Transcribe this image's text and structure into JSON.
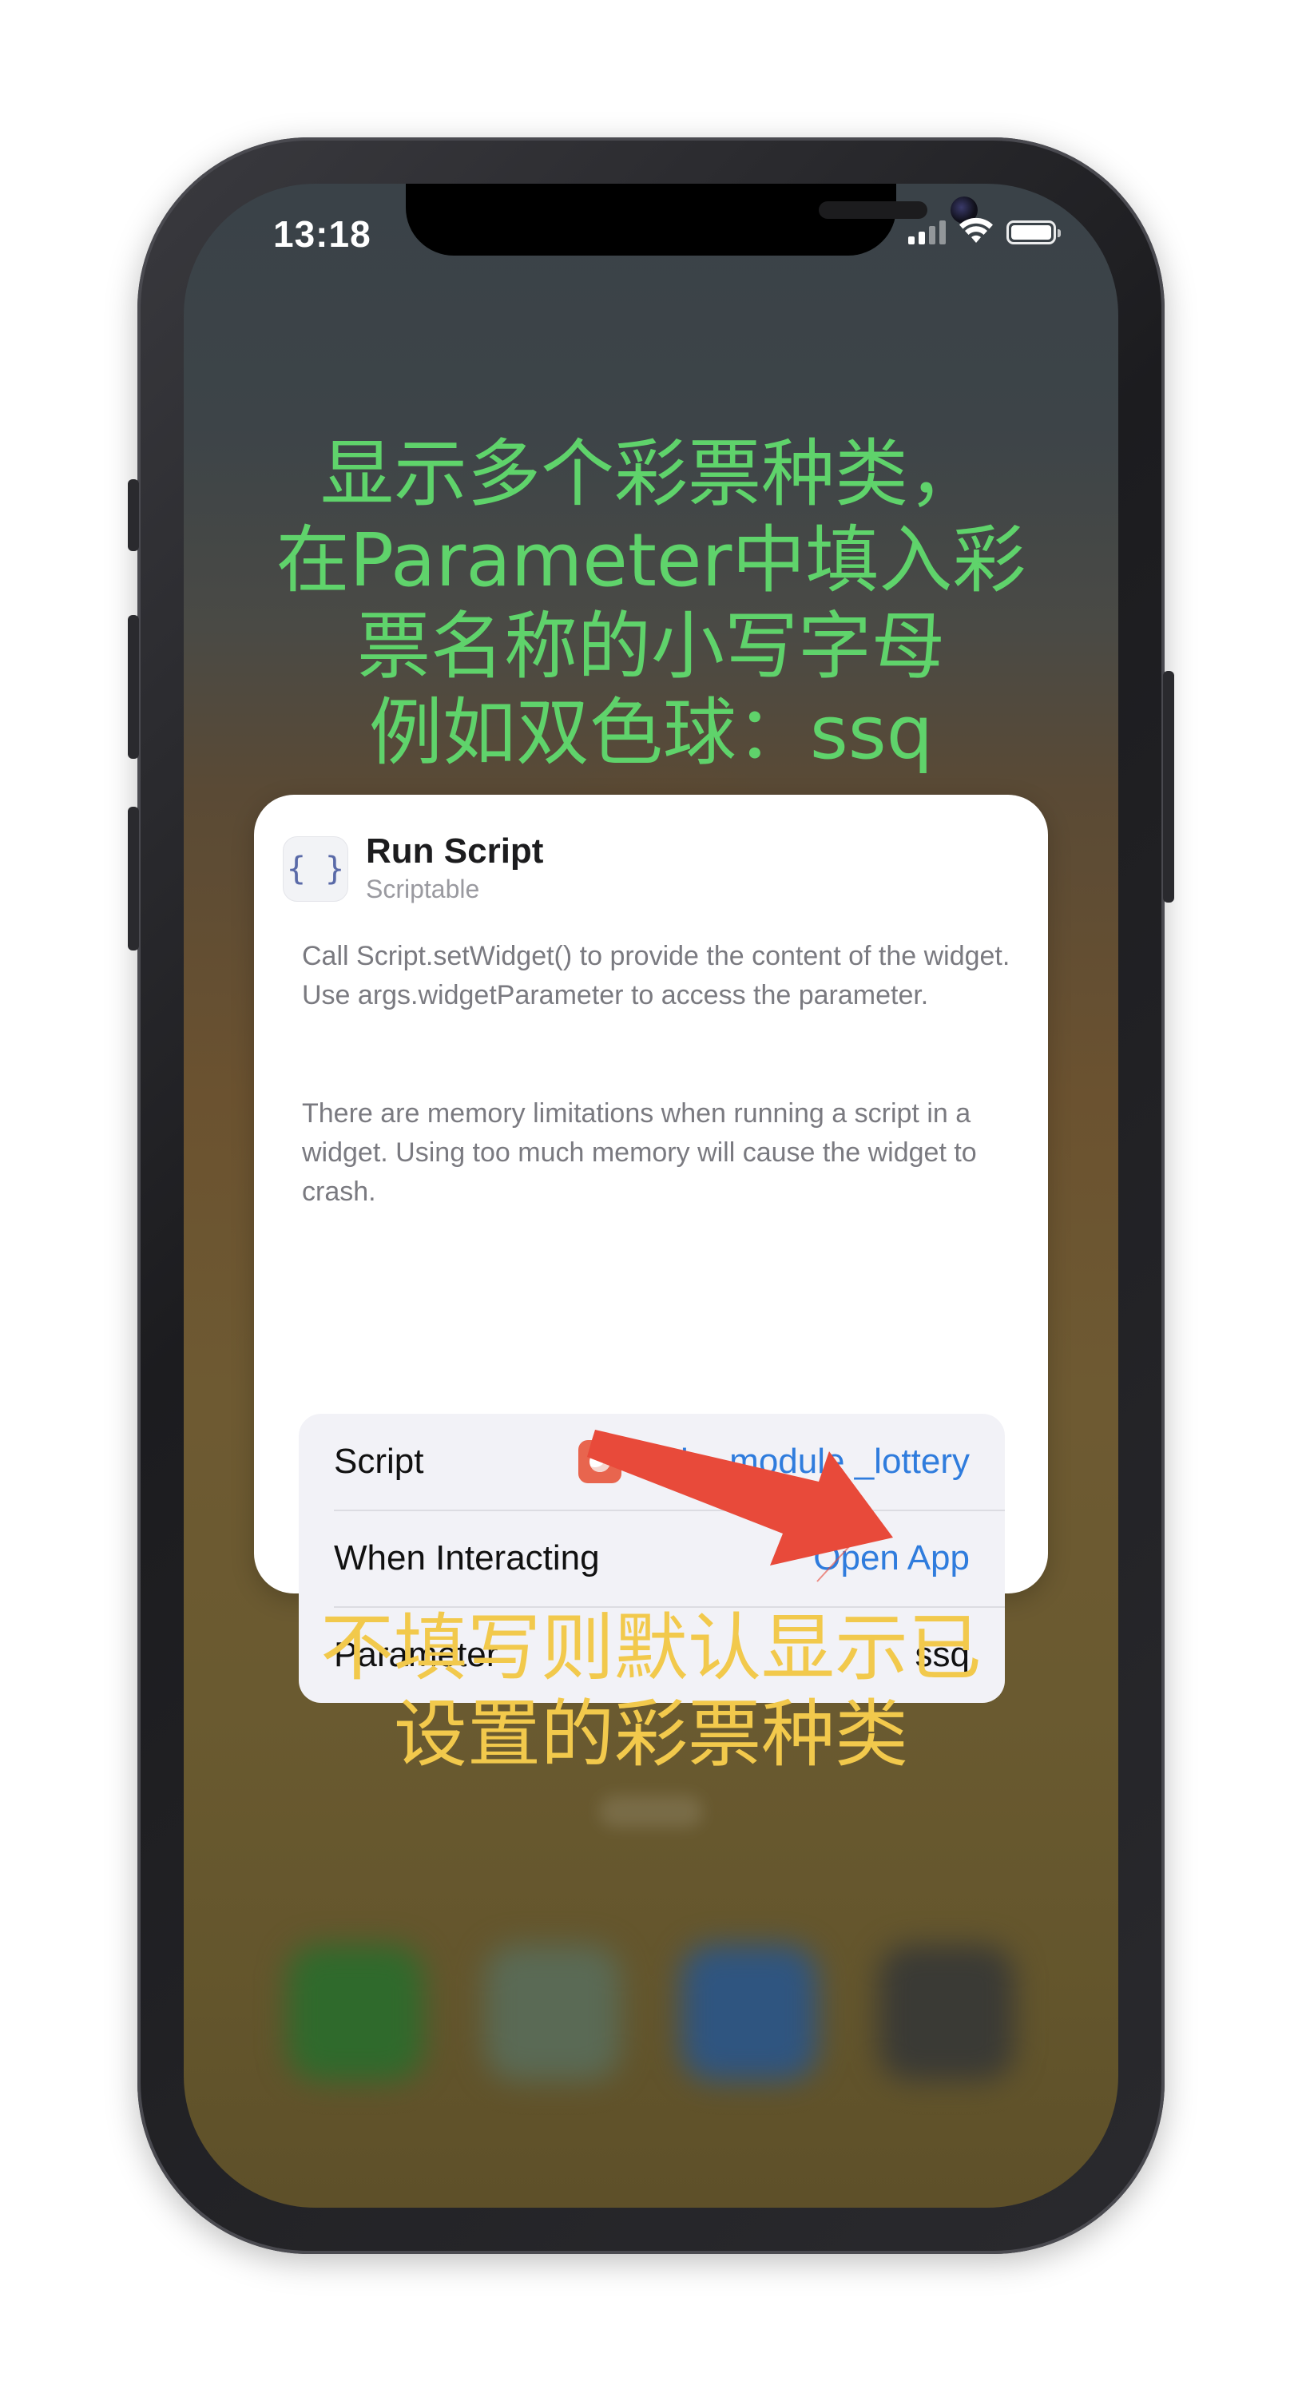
{
  "status_bar": {
    "time": "13:18"
  },
  "caption_top": {
    "lines": [
      "显示多个彩票种类，",
      "在Parameter中填入彩",
      "票名称的小写字母",
      "例如双色球：ssq"
    ],
    "color": "#5fd36b"
  },
  "card": {
    "title": "Run Script",
    "subtitle": "Scriptable",
    "icon": "{ }",
    "description_1": "Call Script.setWidget() to provide the content of the widget. Use args.widgetParameter to access the parameter.",
    "description_2": "There are memory limitations when running a script in a widget. Using too much memory will cause the widget to crash.",
    "params": [
      {
        "label": "Script",
        "value": "web_ module _lottery"
      },
      {
        "label": "When Interacting",
        "value": "Open App"
      },
      {
        "label": "Parameter",
        "value": "ssq"
      }
    ]
  },
  "caption_bottom": {
    "lines": [
      "不填写则默认显示已",
      "设置的彩票种类"
    ],
    "color": "#f2c94c"
  },
  "colors": {
    "link": "#2f7cdd",
    "arrow": "#e84a3a"
  }
}
